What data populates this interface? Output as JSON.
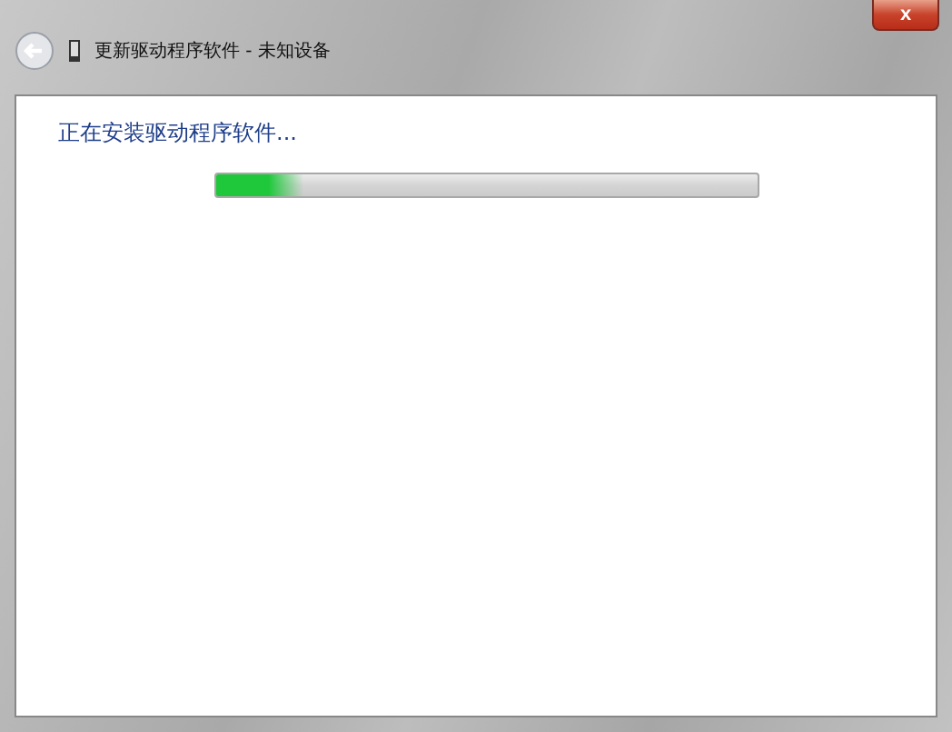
{
  "window": {
    "title": "更新驱动程序软件 - 未知设备",
    "close": "x"
  },
  "content": {
    "heading": "正在安装驱动程序软件...",
    "progress": {
      "level": 0.16
    }
  }
}
